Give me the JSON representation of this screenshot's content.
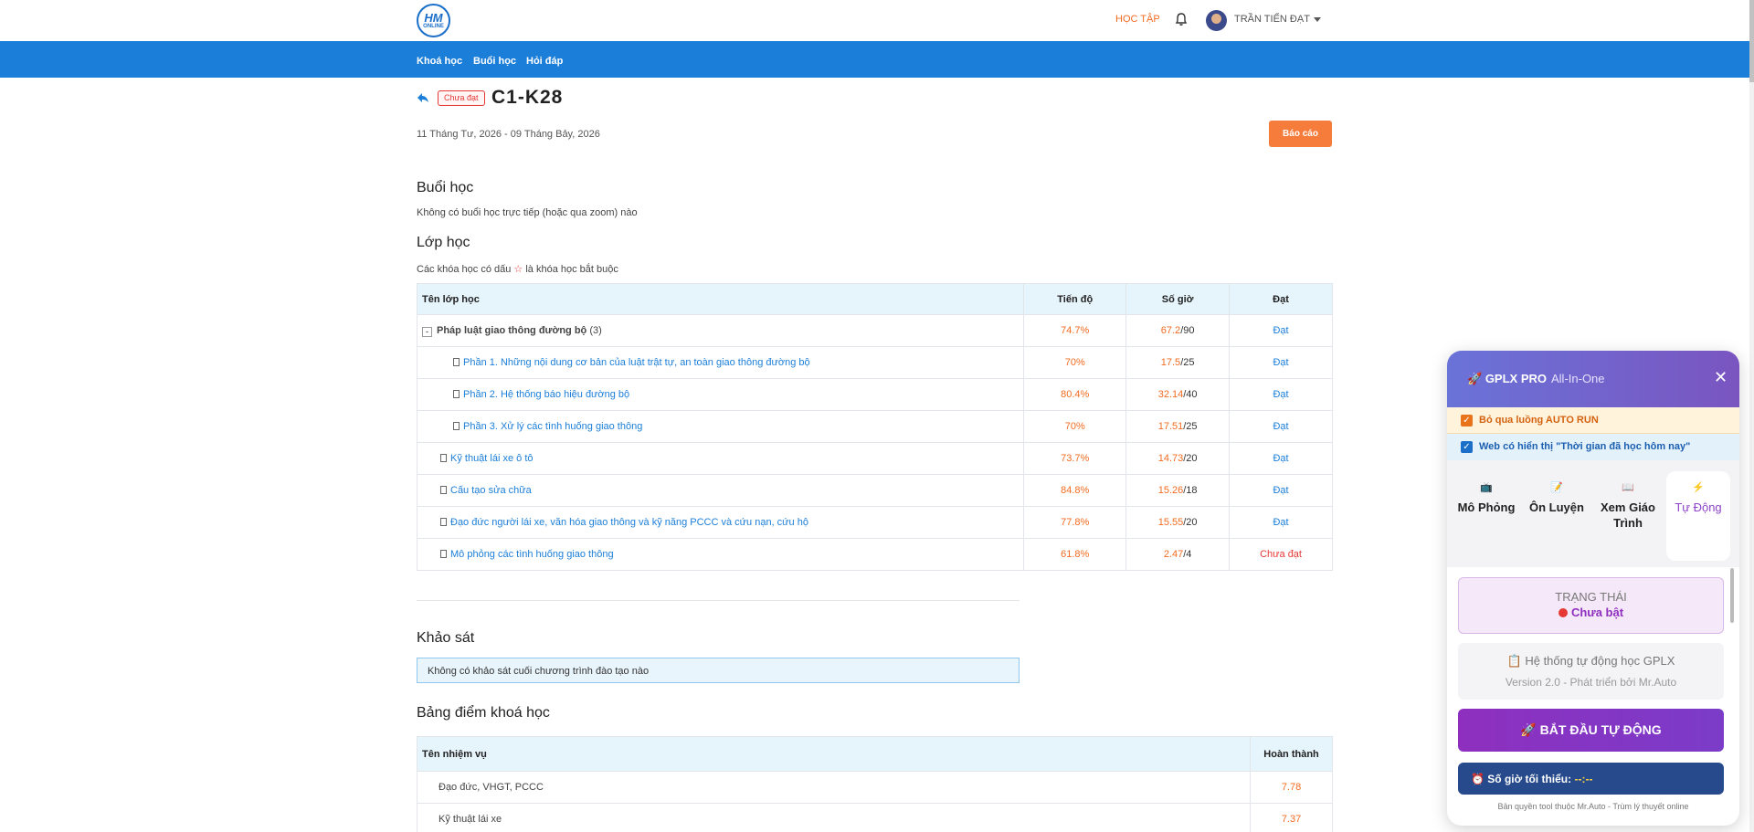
{
  "header": {
    "logo_text_big": "HM",
    "logo_text_small": "ONLINE",
    "nav_hoctap": "HỌC TẬP",
    "username": "TRẦN TIẾN ĐẠT"
  },
  "nav": {
    "items": [
      "Khoá học",
      "Buổi học",
      "Hỏi đáp"
    ]
  },
  "course": {
    "status_badge": "Chưa đạt",
    "title": "C1-K28",
    "date_range": "11 Tháng Tư, 2026 - 09 Tháng Bảy, 2026",
    "report_button": "Báo cáo"
  },
  "sessions": {
    "heading": "Buổi học",
    "note": "Không có buổi học trực tiếp (hoặc qua zoom) nào"
  },
  "classes": {
    "heading": "Lớp học",
    "note_prefix": "Các khóa học có dấu",
    "note_star": "☆",
    "note_suffix": "là khóa học bắt buộc",
    "columns": [
      "Tên lớp học",
      "Tiến độ",
      "Số giờ",
      "Đạt"
    ],
    "rows": [
      {
        "name": "Pháp luật giao thông đường bộ",
        "count": "(3)",
        "progress": "74.7%",
        "hours_done": "67.2",
        "hours_total": "/90",
        "status": "Đạt"
      },
      {
        "name": "Phần 1. Những nội dung cơ bản của luật trật tự, an toàn giao thông đường bộ",
        "progress": "70%",
        "hours_done": "17.5",
        "hours_total": "/25",
        "status": "Đạt"
      },
      {
        "name": "Phần 2. Hệ thống báo hiệu đường bộ",
        "progress": "80.4%",
        "hours_done": "32.14",
        "hours_total": "/40",
        "status": "Đạt"
      },
      {
        "name": "Phần 3. Xử lý các tình huống giao thông",
        "progress": "70%",
        "hours_done": "17.51",
        "hours_total": "/25",
        "status": "Đạt"
      },
      {
        "name": "Kỹ thuật lái xe ô tô",
        "progress": "73.7%",
        "hours_done": "14.73",
        "hours_total": "/20",
        "status": "Đạt"
      },
      {
        "name": "Cấu tạo sửa chữa",
        "progress": "84.8%",
        "hours_done": "15.26",
        "hours_total": "/18",
        "status": "Đạt"
      },
      {
        "name": "Đạo đức người lái xe, văn hóa giao thông và kỹ năng PCCC và cứu nạn, cứu hộ",
        "progress": "77.8%",
        "hours_done": "15.55",
        "hours_total": "/20",
        "status": "Đạt"
      },
      {
        "name": "Mô phỏng các tình huống giao thông",
        "progress": "61.8%",
        "hours_done": "2.47",
        "hours_total": "/4",
        "status": "Chưa đạt"
      }
    ]
  },
  "survey": {
    "heading": "Khảo sát",
    "note": "Không có khảo sát cuối chương trình đào tạo nào"
  },
  "scores": {
    "heading": "Bảng điểm khoá học",
    "columns": [
      "Tên nhiệm vụ",
      "Hoàn thành"
    ],
    "rows": [
      {
        "task": "Đạo đức, VHGT, PCCC",
        "score": "7.78"
      },
      {
        "task": "Kỹ thuật lái xe",
        "score": "7.37"
      }
    ]
  },
  "extension": {
    "title": "GPLX PRO",
    "subtitle": "All-In-One",
    "close": "✕",
    "option1": "Bỏ qua luồng AUTO RUN",
    "option2": "Web có hiển thị \"Thời gian đã học hôm nay\"",
    "tabs": [
      {
        "icon": "📺",
        "label": "Mô Phỏng"
      },
      {
        "icon": "📝",
        "label": "Ôn Luyện"
      },
      {
        "icon": "📖",
        "label": "Xem Giáo Trình"
      },
      {
        "icon": "⚡",
        "label": "Tự Động"
      }
    ],
    "status_label": "TRẠNG THÁI",
    "status_value": "Chưa bật",
    "info_line1": "📋 Hệ thống tự động học GPLX",
    "info_line2": "Version 2.0 - Phát triển bởi Mr.Auto",
    "start_button": "🚀 BẮT ĐẦU TỰ ĐỘNG",
    "min_hours_label": "⏰ Số giờ tối thiểu:",
    "min_hours_value": "--:--",
    "copyright": "Bản quyền tool thuộc Mr.Auto - Trùm lý thuyết online"
  },
  "colors": {
    "primary_blue": "#1b7ed8",
    "accent_orange": "#f26b21",
    "fail_red": "#e53935",
    "ext_purple": "#8e2fbf"
  }
}
